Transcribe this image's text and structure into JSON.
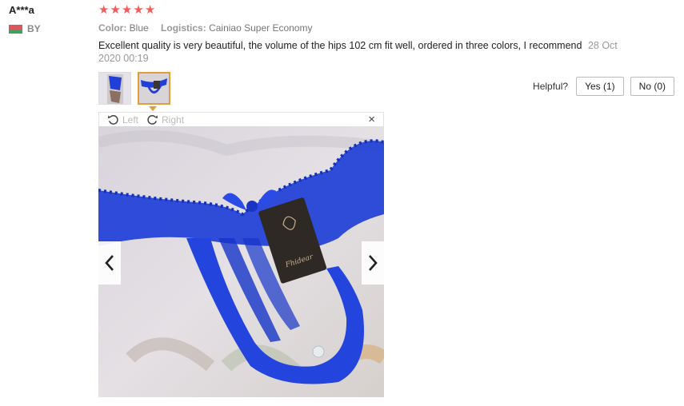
{
  "reviewer": {
    "name": "A***a",
    "country_code": "BY"
  },
  "rating": {
    "stars": 5,
    "max": 5,
    "color": "#f05d5d"
  },
  "attributes": {
    "color_label": "Color:",
    "color_value": "Blue",
    "logistics_label": "Logistics:",
    "logistics_value": "Cainiao Super Economy"
  },
  "review": {
    "text": "Excellent quality is very beautiful, the volume of the hips 102 cm fit well, ordered in three colors, I recommend",
    "date": "28 Oct 2020 00:19"
  },
  "helpful": {
    "label": "Helpful?",
    "yes_label": "Yes (1)",
    "no_label": "No (0)"
  },
  "viewer": {
    "rotate_left_label": "Left",
    "rotate_right_label": "Right",
    "close_symbol": "×",
    "product_tag_text": "Fhidear"
  },
  "colors": {
    "accent": "#e39c39",
    "product_blue": "#1f3fd8"
  }
}
